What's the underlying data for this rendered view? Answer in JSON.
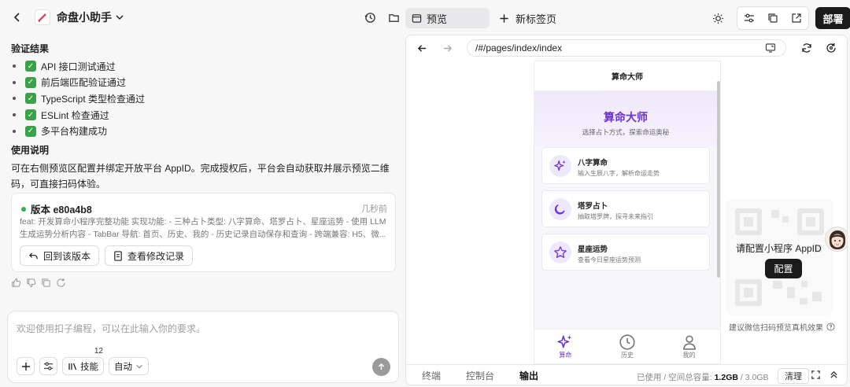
{
  "app": {
    "title": "命盘小助手"
  },
  "tabs": {
    "preview_label": "预览",
    "new_tab_label": "新标签页"
  },
  "toolbar": {
    "deploy_label": "部署"
  },
  "chat": {
    "verify_title": "验证结果",
    "checks": [
      "API 接口测试通过",
      "前后端匹配验证通过",
      "TypeScript 类型检查通过",
      "ESLint 检查通过",
      "多平台构建成功"
    ],
    "usage_title": "使用说明",
    "usage_text": "可在右侧预览区配置并绑定开放平台 AppID。完成授权后，平台会自动获取并展示预览二维码，可直接扫码体验。",
    "version": {
      "label": "版本 e80a4b8",
      "time": "几秒前",
      "desc": "feat: 开发算命小程序完整功能 实现功能: - 三种占卜类型: 八字算命、塔罗占卜、星座运势 - 使用 LLM 生成运势分析内容 - TabBar 导航: 首页、历史、我的 - 历史记录自动保存和查询 - 跨端兼容: H5、微...",
      "rollback_label": "回到该版本",
      "changes_label": "查看修改记录"
    },
    "input": {
      "placeholder": "欢迎使用扣子编程，可以在此输入你的要求。",
      "skills_label": "技能",
      "skills_count": "12",
      "mode_label": "自动"
    }
  },
  "preview": {
    "url": "/#/pages/index/index",
    "phone": {
      "nav_title": "算命大师",
      "hero_title": "算命大师",
      "hero_sub": "选择占卜方式，探索命运奥秘",
      "cards": [
        {
          "title": "八字算命",
          "desc": "输入生辰八字，解析命运走势",
          "icon": "sparkle-icon"
        },
        {
          "title": "塔罗占卜",
          "desc": "抽取塔罗牌，探寻未来指引",
          "icon": "moon-icon"
        },
        {
          "title": "星座运势",
          "desc": "查看今日星座运势预测",
          "icon": "star-icon"
        }
      ],
      "tabbar": [
        {
          "label": "算命",
          "active": true
        },
        {
          "label": "历史",
          "active": false
        },
        {
          "label": "我的",
          "active": false
        }
      ]
    },
    "qr": {
      "text": "请配置小程序 AppID",
      "button_label": "配置",
      "hint": "建议微信扫码预览真机效果"
    },
    "bottom": {
      "tabs": [
        "终端",
        "控制台",
        "输出"
      ],
      "active_tab": "输出",
      "storage_prefix": "已使用 / 空间总容量:",
      "storage_used": "1.2GB",
      "storage_sep": " / ",
      "storage_total": "3.0GB",
      "clear_label": "清理"
    }
  },
  "colors": {
    "accent_purple": "#6b2fd6",
    "check_green": "#3aa34a",
    "dark_button": "#1b1b1b"
  }
}
